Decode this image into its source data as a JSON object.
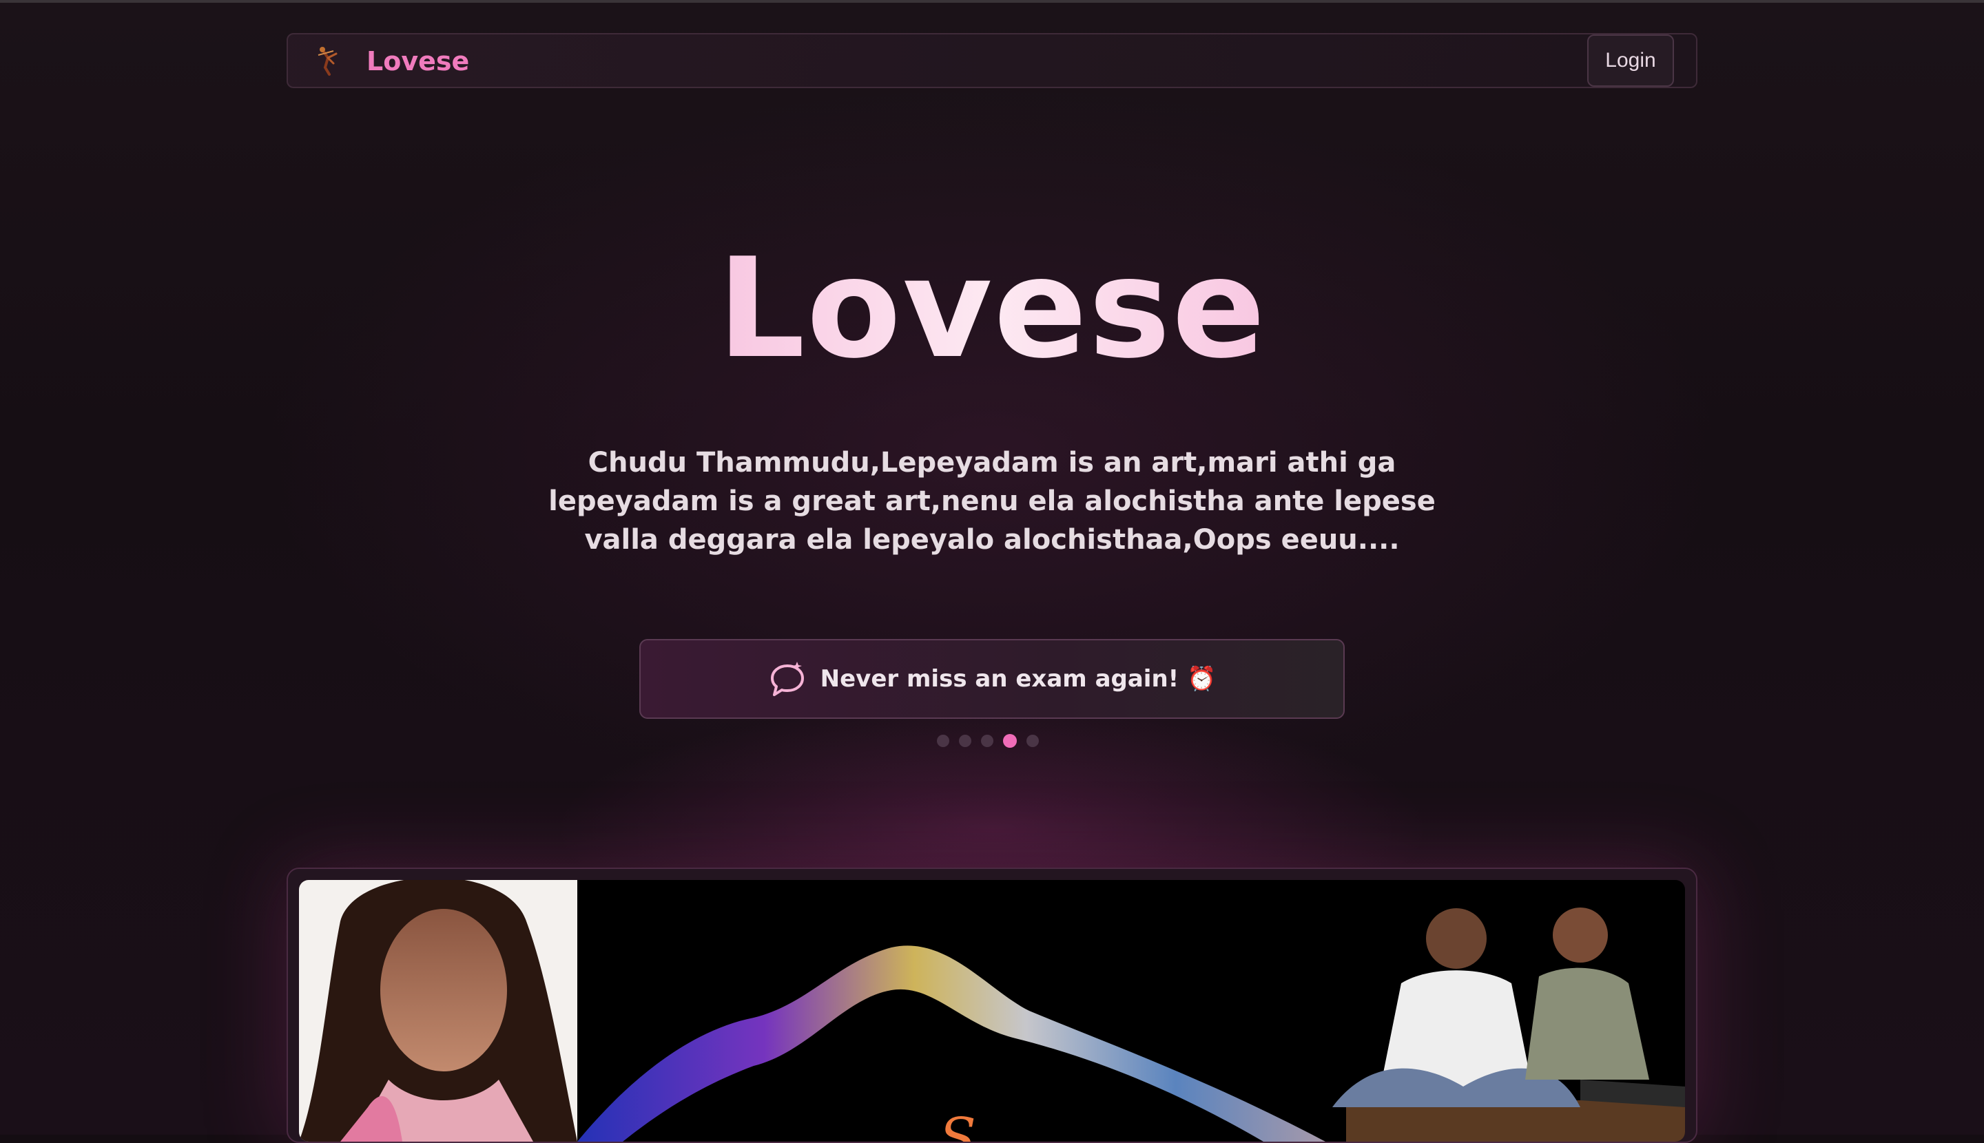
{
  "nav": {
    "brand": "Lovese",
    "login_label": "Login",
    "brand_icon": "cupid-icon"
  },
  "hero": {
    "title": "Lovese",
    "subtitle": "Chudu Thammudu,Lepeyadam is an art,mari athi ga lepeyadam is a great art,nenu ela alochistha ante lepese valla deggara ela lepeyalo alochisthaa,Oops eeuu...."
  },
  "ticker": {
    "icon": "chat-bubble-icon",
    "text": "Never miss an exam again! ⏰",
    "active_index": 3,
    "count": 5
  },
  "colors": {
    "accent": "#f06cb8",
    "background": "#140d12",
    "banner_text": "#f07a3c"
  }
}
